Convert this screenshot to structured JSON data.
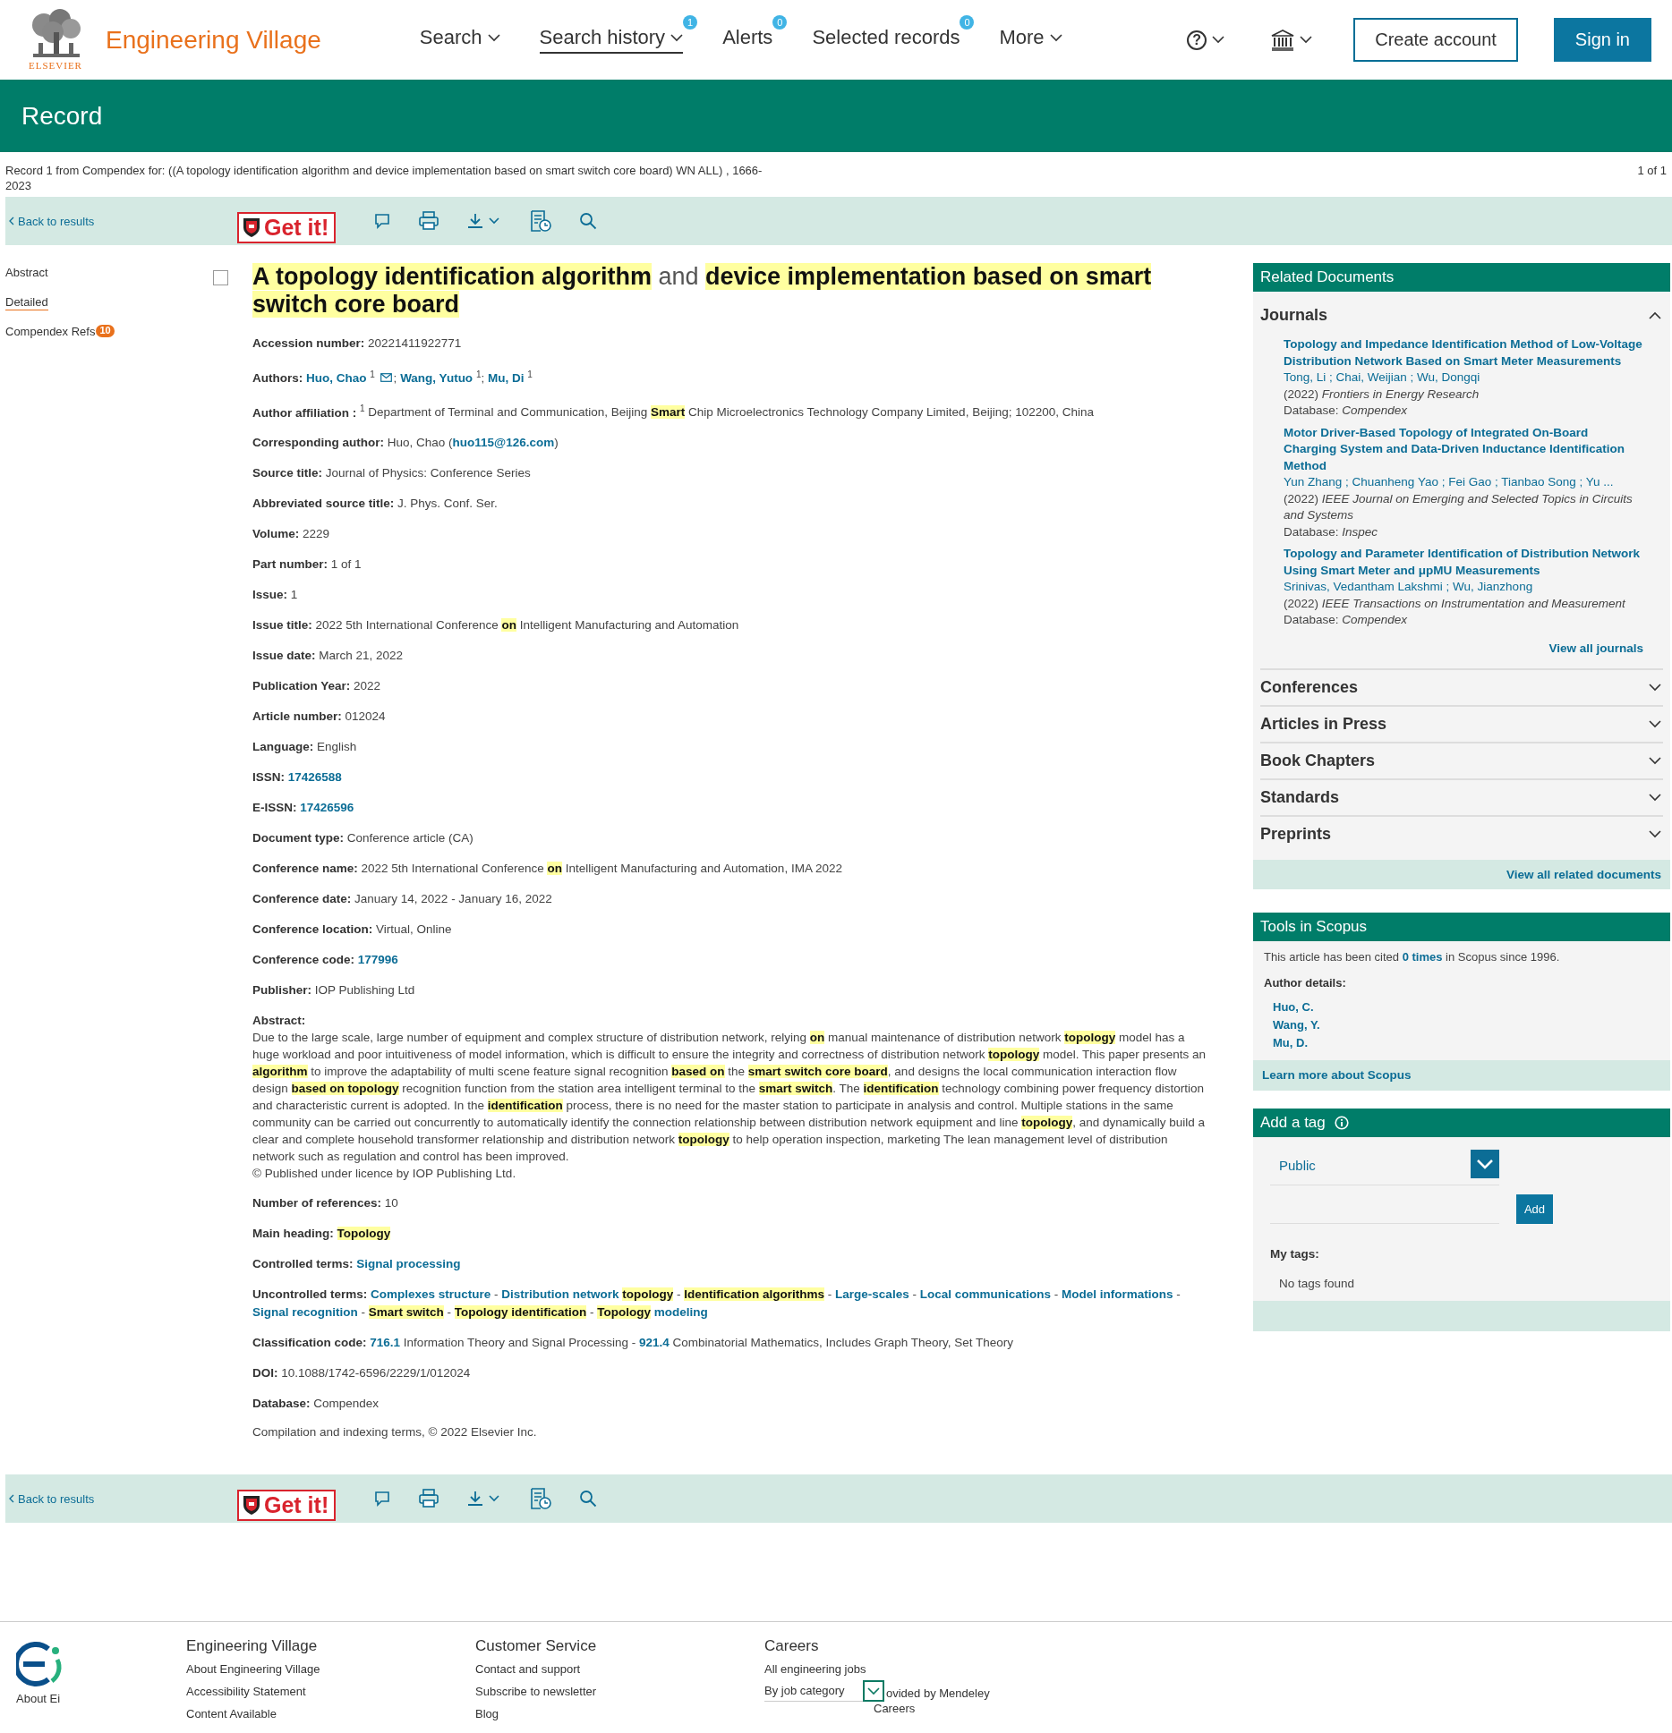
{
  "header": {
    "brand": "Engineering Village",
    "publisher": "ELSEVIER",
    "nav": [
      {
        "label": "Search",
        "selected": false,
        "dropdown": true
      },
      {
        "label": "Search history",
        "selected": true,
        "dropdown": true,
        "badge": "1"
      },
      {
        "label": "Alerts",
        "selected": false,
        "dropdown": false,
        "badge": "0"
      },
      {
        "label": "Selected records",
        "selected": false,
        "dropdown": false,
        "badge": "0"
      },
      {
        "label": "More",
        "selected": false,
        "dropdown": true
      }
    ],
    "help": "?",
    "create_account": "Create account",
    "sign_in": "Sign in"
  },
  "banner": {
    "title": "Record"
  },
  "record_info": {
    "query": "Record 1 from Compendex for: ((A topology identification algorithm and device implementation based on smart switch core board) WN ALL) , 1666-2023",
    "position": "1 of 1"
  },
  "toolbars": [
    {
      "back": "Back to results",
      "get_it": "Get it!"
    },
    {
      "back": "Back to results",
      "get_it": "Get it!"
    }
  ],
  "side_nav": [
    {
      "label": "Abstract",
      "selected": false
    },
    {
      "label": "Detailed",
      "selected": true
    },
    {
      "label": "Compendex Refs",
      "selected": false,
      "badge": "10"
    }
  ],
  "record": {
    "checked": false,
    "title": "**A topology identification algorithm** and **device implementation based on smart switch core board**",
    "fields": [
      {
        "label": "Accession number:",
        "parts": [
          {
            "kind": "text",
            "text": "20221411922771"
          }
        ]
      },
      {
        "label": "Authors:",
        "parts": [
          {
            "kind": "link",
            "text": "Huo, Chao"
          },
          {
            "kind": "text",
            "text": " $^{1}$ "
          },
          {
            "kind": "mail"
          },
          {
            "kind": "text",
            "text": "; "
          },
          {
            "kind": "link",
            "text": "Wang, Yutuo"
          },
          {
            "kind": "text",
            "text": " $^{1}$; "
          },
          {
            "kind": "link",
            "text": "Mu, Di"
          },
          {
            "kind": "text",
            "text": " $^{1}$"
          }
        ]
      },
      {
        "label": "Author affiliation :",
        "parts": [
          {
            "kind": "text",
            "text": "$^{1}$ Department of Terminal and Communication, Beijing **Smart** Chip Microelectronics Technology Company Limited, Beijing; 102200, China"
          }
        ]
      },
      {
        "label": "Corresponding author:",
        "parts": [
          {
            "kind": "text",
            "text": "Huo, Chao ("
          },
          {
            "kind": "link",
            "text": "huo115@126.com"
          },
          {
            "kind": "text",
            "text": ")"
          }
        ]
      },
      {
        "label": "Source title:",
        "parts": [
          {
            "kind": "text",
            "text": "Journal of Physics: Conference Series"
          }
        ]
      },
      {
        "label": "Abbreviated source title:",
        "parts": [
          {
            "kind": "text",
            "text": "J. Phys. Conf. Ser."
          }
        ]
      },
      {
        "label": "Volume:",
        "parts": [
          {
            "kind": "text",
            "text": "2229"
          }
        ]
      },
      {
        "label": "Part number:",
        "parts": [
          {
            "kind": "text",
            "text": "1 of 1"
          }
        ]
      },
      {
        "label": "Issue:",
        "parts": [
          {
            "kind": "text",
            "text": "1"
          }
        ]
      },
      {
        "label": "Issue title:",
        "parts": [
          {
            "kind": "text",
            "text": "2022 5th International Conference **on** Intelligent Manufacturing and Automation"
          }
        ]
      },
      {
        "label": "Issue date:",
        "parts": [
          {
            "kind": "text",
            "text": "March 21, 2022"
          }
        ]
      },
      {
        "label": "Publication Year:",
        "parts": [
          {
            "kind": "text",
            "text": "2022"
          }
        ]
      },
      {
        "label": "Article number:",
        "parts": [
          {
            "kind": "text",
            "text": "012024"
          }
        ]
      },
      {
        "label": "Language:",
        "parts": [
          {
            "kind": "text",
            "text": "English"
          }
        ]
      },
      {
        "label": "ISSN:",
        "parts": [
          {
            "kind": "link",
            "text": "17426588"
          }
        ]
      },
      {
        "label": "E-ISSN:",
        "parts": [
          {
            "kind": "link",
            "text": "17426596"
          }
        ]
      },
      {
        "label": "Document type:",
        "parts": [
          {
            "kind": "text",
            "text": "Conference article (CA)"
          }
        ]
      },
      {
        "label": "Conference name:",
        "parts": [
          {
            "kind": "text",
            "text": "2022 5th International Conference **on** Intelligent Manufacturing and Automation, IMA 2022"
          }
        ]
      },
      {
        "label": "Conference date:",
        "parts": [
          {
            "kind": "text",
            "text": "January 14, 2022 - January 16, 2022"
          }
        ]
      },
      {
        "label": "Conference location:",
        "parts": [
          {
            "kind": "text",
            "text": "Virtual, Online"
          }
        ]
      },
      {
        "label": "Conference code:",
        "parts": [
          {
            "kind": "link",
            "text": "177996"
          }
        ]
      },
      {
        "label": "Publisher:",
        "parts": [
          {
            "kind": "text",
            "text": "IOP Publishing Ltd"
          }
        ]
      }
    ],
    "abstract": {
      "label": "Abstract:",
      "text": "Due to the large scale, large number of equipment and complex structure of distribution network, relying **on** manual maintenance of distribution network **topology** model has a huge workload and poor intuitiveness of model information, which is difficult to ensure the integrity and correctness of distribution network **topology** model. This paper presents an **algorithm** to improve the adaptability of multi scene feature signal recognition **based on** the **smart switch core board**, and designs the local communication interaction flow design **based on topology** recognition function from the station area intelligent terminal to the **smart switch**. The **identification** technology combining power frequency distortion and characteristic current is adopted. In the **identification** process, there is no need for the master station to participate in analysis and control. Multiple stations in the same community can be carried out concurrently to automatically identify the connection relationship between distribution network equipment and line **topology**, and dynamically build a clear and complete household transformer relationship and distribution network **topology** to help operation inspection, marketing The lean management level of distribution network such as regulation and control has been improved.",
      "copyright": "© Published under licence by IOP Publishing Ltd."
    },
    "more_fields": [
      {
        "label": "Number of references:",
        "parts": [
          {
            "kind": "text",
            "text": "10"
          }
        ]
      },
      {
        "label": "Main heading:",
        "parts": [
          {
            "kind": "text",
            "text": "**Topology**"
          }
        ]
      },
      {
        "label": "Controlled terms:",
        "parts": [
          {
            "kind": "link",
            "text": "Signal processing"
          }
        ]
      },
      {
        "label": "Uncontrolled terms:",
        "parts": [
          {
            "kind": "link",
            "text": "Complexes structure"
          },
          {
            "kind": "text",
            "text": " - "
          },
          {
            "kind": "link",
            "text": "Distribution network **topology**"
          },
          {
            "kind": "text",
            "text": " - "
          },
          {
            "kind": "link",
            "text": "**Identification algorithms**"
          },
          {
            "kind": "text",
            "text": " - "
          },
          {
            "kind": "link",
            "text": "Large-scales"
          },
          {
            "kind": "text",
            "text": " - "
          },
          {
            "kind": "link",
            "text": "Local communications"
          },
          {
            "kind": "text",
            "text": " - "
          },
          {
            "kind": "link",
            "text": "Model informations"
          },
          {
            "kind": "text",
            "text": " - "
          },
          {
            "kind": "link",
            "text": "Signal recognition"
          },
          {
            "kind": "text",
            "text": " - "
          },
          {
            "kind": "link",
            "text": "**Smart switch**"
          },
          {
            "kind": "text",
            "text": " - "
          },
          {
            "kind": "link",
            "text": "**Topology identification**"
          },
          {
            "kind": "text",
            "text": " - "
          },
          {
            "kind": "link",
            "text": "**Topology** modeling"
          }
        ]
      },
      {
        "label": "Classification code:",
        "parts": [
          {
            "kind": "link",
            "text": "716.1"
          },
          {
            "kind": "text",
            "text": " Information Theory and Signal Processing  - "
          },
          {
            "kind": "link",
            "text": "921.4"
          },
          {
            "kind": "text",
            "text": " Combinatorial Mathematics, Includes Graph Theory, Set Theory"
          }
        ]
      },
      {
        "label": "DOI:",
        "parts": [
          {
            "kind": "text",
            "text": "10.1088/1742-6596/2229/1/012024"
          }
        ]
      },
      {
        "label": "Database:",
        "parts": [
          {
            "kind": "text",
            "text": "Compendex"
          }
        ]
      }
    ],
    "note": "Compilation and indexing terms, © 2022 Elsevier Inc."
  },
  "related": {
    "title": "Related Documents",
    "sections": [
      {
        "label": "Journals",
        "expanded": true,
        "items": [
          {
            "title": "Topology and Impedance Identification Method of Low-Voltage Distribution Network Based on Smart Meter Measurements",
            "authors": "Tong, Li ; Chai, Weijian ; Wu, Dongqi",
            "source": "(2022) *Frontiers in Energy Research*",
            "database": "Database: *Compendex*"
          },
          {
            "title": "Motor Driver-Based Topology of Integrated On-Board Charging System and Data-Driven Inductance Identification Method",
            "authors": "Yun Zhang ; Chuanheng Yao ; Fei Gao ; Tianbao Song ; Yu ...",
            "source": "(2022) *IEEE Journal on Emerging and Selected Topics in Circuits and Systems*",
            "database": "Database: *Inspec*"
          },
          {
            "title": "Topology and Parameter Identification of Distribution Network Using Smart Meter and μpMU Measurements",
            "authors": "Srinivas, Vedantham Lakshmi ; Wu, Jianzhong",
            "source": "(2022) *IEEE Transactions on Instrumentation and Measurement*",
            "database": "Database: *Compendex*"
          }
        ],
        "view_all": "View all journals"
      },
      {
        "label": "Conferences",
        "expanded": false
      },
      {
        "label": "Articles in Press",
        "expanded": false
      },
      {
        "label": "Book Chapters",
        "expanded": false
      },
      {
        "label": "Standards",
        "expanded": false
      },
      {
        "label": "Preprints",
        "expanded": false
      }
    ],
    "view_all": "View all related documents"
  },
  "scopus": {
    "title": "Tools in Scopus",
    "cited_before": "This article has been cited ",
    "cited_link": "0 times",
    "cited_after": " in Scopus since 1996.",
    "author_details": "Author details:",
    "authors": [
      "Huo, C.",
      "Wang, Y.",
      "Mu, D."
    ],
    "learn_more": "Learn more about Scopus"
  },
  "tag": {
    "title": "Add a tag",
    "visibility": "Public",
    "add": "Add",
    "my_tags": "My tags:",
    "empty": "No tags found"
  },
  "footer": {
    "about": "About Ei",
    "columns": [
      {
        "heading": "Engineering Village",
        "links": [
          "About Engineering Village",
          "Accessibility Statement",
          "Content Available"
        ]
      },
      {
        "heading": "Customer Service",
        "links": [
          "Contact and support",
          "Subscribe to newsletter",
          "Blog"
        ]
      },
      {
        "heading": "Careers",
        "links": [
          "All engineering jobs"
        ],
        "select": "By job category",
        "note": "ovided by Mendeley",
        "sub_link": "Careers"
      }
    ]
  }
}
